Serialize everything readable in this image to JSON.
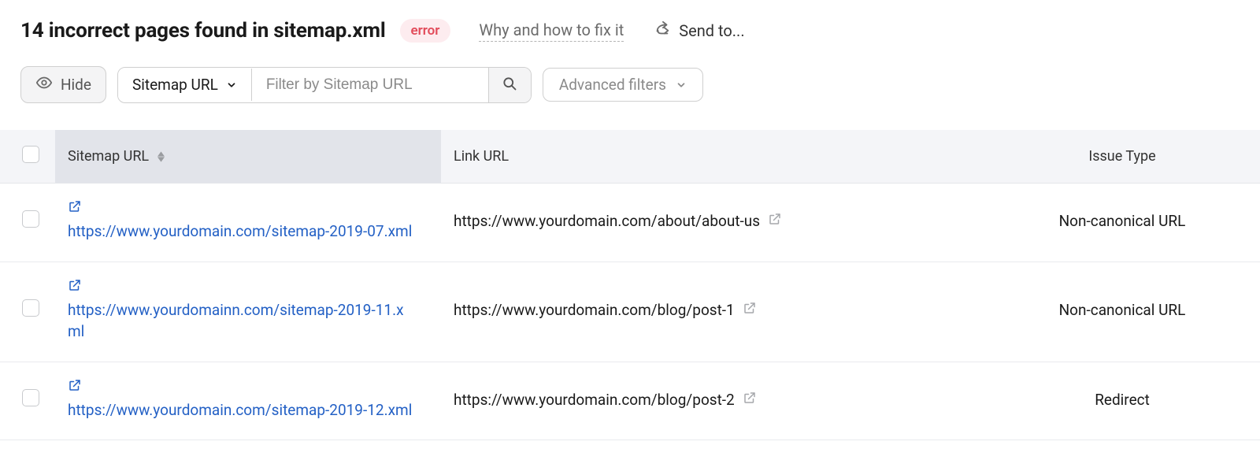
{
  "header": {
    "title": "14 incorrect pages found in sitemap.xml",
    "badge": "error",
    "help_link": "Why and how to fix it",
    "send_to": "Send to..."
  },
  "controls": {
    "hide_label": "Hide",
    "filter_field_label": "Sitemap URL",
    "filter_placeholder": "Filter by Sitemap URL",
    "advanced_label": "Advanced filters"
  },
  "table": {
    "columns": {
      "sitemap": "Sitemap URL",
      "link": "Link URL",
      "issue": "Issue Type"
    },
    "rows": [
      {
        "sitemap_url": "https://www.yourdomain.com/sitemap-2019-07.xml",
        "link_url": "https://www.yourdomain.com/about/about-us",
        "issue": "Non-canonical URL"
      },
      {
        "sitemap_url": "https://www.yourdomainn.com/sitemap-2019-11.xml",
        "link_url": "https://www.yourdomain.com/blog/post-1",
        "issue": "Non-canonical URL"
      },
      {
        "sitemap_url": "https://www.yourdomain.com/sitemap-2019-12.xml",
        "link_url": "https://www.yourdomain.com/blog/post-2",
        "issue": "Redirect"
      }
    ]
  }
}
